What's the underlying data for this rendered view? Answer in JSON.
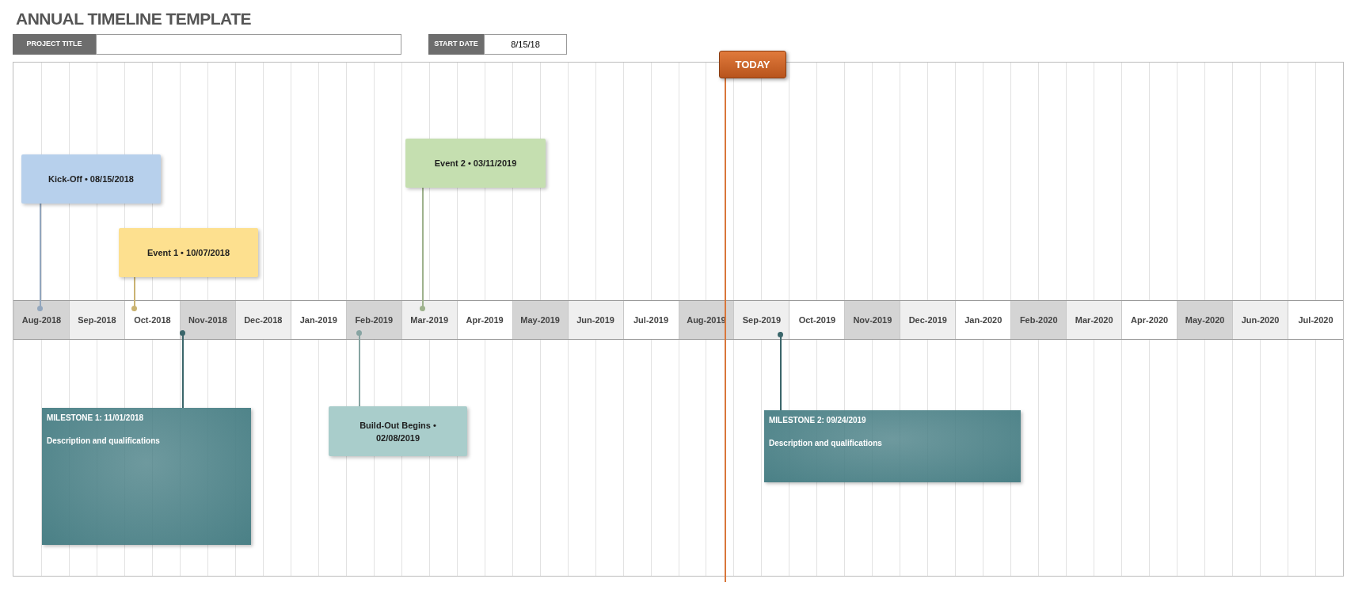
{
  "title": "ANNUAL TIMELINE TEMPLATE",
  "header": {
    "project_title": {
      "label": "PROJECT TITLE"
    },
    "start_date": {
      "label": "START DATE",
      "value": "8/15/18"
    }
  },
  "today_marker": {
    "label": "TODAY"
  },
  "months": [
    {
      "label": "Aug-2018",
      "color": "#d4d4d4"
    },
    {
      "label": "Sep-2018",
      "color": "#efefef"
    },
    {
      "label": "Oct-2018",
      "color": "#ffffff"
    },
    {
      "label": "Nov-2018",
      "color": "#d4d4d4"
    },
    {
      "label": "Dec-2018",
      "color": "#efefef"
    },
    {
      "label": "Jan-2019",
      "color": "#ffffff"
    },
    {
      "label": "Feb-2019",
      "color": "#d4d4d4"
    },
    {
      "label": "Mar-2019",
      "color": "#efefef"
    },
    {
      "label": "Apr-2019",
      "color": "#ffffff"
    },
    {
      "label": "May-2019",
      "color": "#d4d4d4"
    },
    {
      "label": "Jun-2019",
      "color": "#efefef"
    },
    {
      "label": "Jul-2019",
      "color": "#ffffff"
    },
    {
      "label": "Aug-2019",
      "color": "#d4d4d4"
    },
    {
      "label": "Sep-2019",
      "color": "#efefef"
    },
    {
      "label": "Oct-2019",
      "color": "#ffffff"
    },
    {
      "label": "Nov-2019",
      "color": "#d4d4d4"
    },
    {
      "label": "Dec-2019",
      "color": "#efefef"
    },
    {
      "label": "Jan-2020",
      "color": "#ffffff"
    },
    {
      "label": "Feb-2020",
      "color": "#d4d4d4"
    },
    {
      "label": "Mar-2020",
      "color": "#efefef"
    },
    {
      "label": "Apr-2020",
      "color": "#ffffff"
    },
    {
      "label": "May-2020",
      "color": "#d4d4d4"
    },
    {
      "label": "Jun-2020",
      "color": "#efefef"
    },
    {
      "label": "Jul-2020",
      "color": "#ffffff"
    }
  ],
  "events": [
    {
      "kind": "event",
      "title": "Kick-Off • 08/15/2018",
      "color": "#b7d0ec"
    },
    {
      "kind": "event",
      "title": "Event 1 • 10/07/2018",
      "color": "#fde08f"
    },
    {
      "kind": "event",
      "title": "Event 2 • 03/11/2019",
      "color": "#c5dfb0"
    },
    {
      "kind": "milestone",
      "title": "MILESTONE 1: 11/01/2018",
      "description": "Description and qualifications",
      "color": "#4a8086"
    },
    {
      "kind": "event",
      "title": "Build-Out Begins • 02/08/2019",
      "color": "#a9cdcb"
    },
    {
      "kind": "milestone",
      "title": "MILESTONE 2: 09/24/2019",
      "description": "Description and qualifications",
      "color": "#4a8086"
    }
  ]
}
